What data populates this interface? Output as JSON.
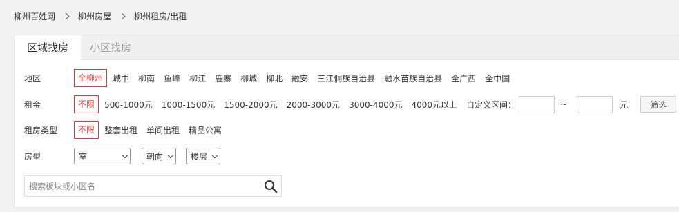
{
  "breadcrumb": [
    "柳州百姓网",
    "柳州房屋",
    "柳州租房/出租"
  ],
  "tabs": [
    {
      "label": "区域找房",
      "active": true
    },
    {
      "label": "小区找房",
      "active": false
    }
  ],
  "filters": {
    "region": {
      "label": "地区",
      "selected": "全柳州",
      "options": [
        "城中",
        "柳南",
        "鱼峰",
        "柳江",
        "鹿寨",
        "柳城",
        "柳北",
        "融安",
        "三江侗族自治县",
        "融水苗族自治县",
        "全广西",
        "全中国"
      ]
    },
    "rent": {
      "label": "租金",
      "selected": "不限",
      "options": [
        "500-1000元",
        "1000-1500元",
        "1500-2000元",
        "2000-3000元",
        "3000-4000元",
        "4000元以上"
      ],
      "custom_label": "自定义区间：",
      "min_value": "",
      "max_value": "",
      "tilde": "~",
      "unit": "元",
      "filter_button": "筛选"
    },
    "rent_type": {
      "label": "租房类型",
      "selected": "不限",
      "options": [
        "整套出租",
        "单间出租",
        "精品公寓"
      ]
    },
    "layout": {
      "label": "房型",
      "room_select": "室",
      "orientation_select": "朝向",
      "floor_select": "楼层"
    }
  },
  "search": {
    "placeholder": "搜索板块或小区名",
    "icon": "search-icon"
  },
  "colors": {
    "accent": "#e4393c",
    "background": "#f2f2f2"
  }
}
